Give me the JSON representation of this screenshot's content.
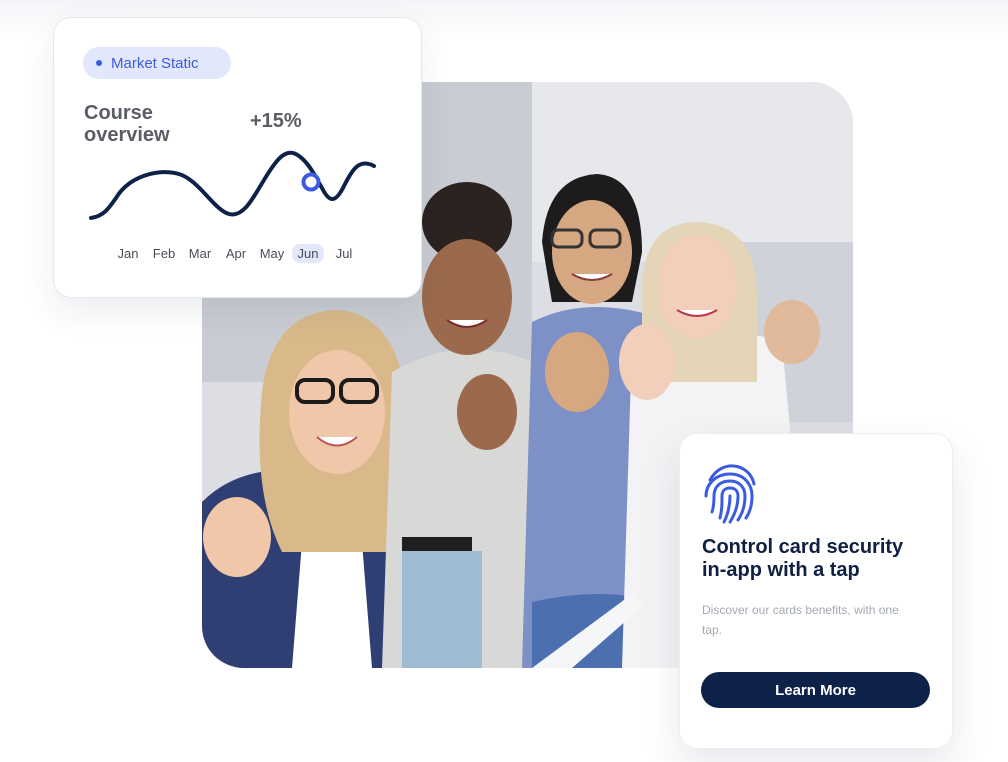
{
  "chart_card": {
    "badge": "Market Static",
    "title": "Course overview",
    "growth": "+15%",
    "months": [
      "Jan",
      "Feb",
      "Mar",
      "Apr",
      "May",
      "Jun",
      "Jul"
    ],
    "active_month": "Jun"
  },
  "security_card": {
    "icon": "fingerprint-icon",
    "title": "Control card security in-app with a tap",
    "description": "Discover our cards benefits, with one tap.",
    "button_label": "Learn More"
  },
  "photo": {
    "subject": "group-photo"
  },
  "colors": {
    "accent": "#3b5be0",
    "accent_soft": "#e3e7fb",
    "navy": "#0e2148",
    "muted_text": "#a5a9b3"
  }
}
